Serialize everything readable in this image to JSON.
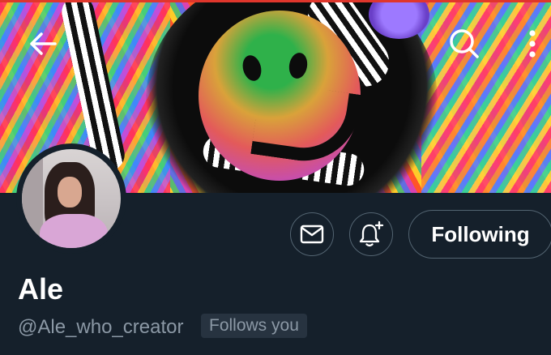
{
  "header": {
    "back_icon": "arrow-left-icon",
    "search_icon": "search-icon",
    "more_icon": "more-vertical-icon",
    "banner_image": "psychedelic-smiley-banner"
  },
  "profile": {
    "avatar_image": "profile-avatar",
    "display_name": "Ale",
    "handle": "@Ale_who_creator",
    "follows_you_label": "Follows you"
  },
  "actions": {
    "message_icon": "mail-icon",
    "notifications_icon": "bell-plus-icon",
    "following_label": "Following"
  },
  "colors": {
    "background": "#15202b",
    "secondary_text": "#8b98a5",
    "border": "#536471",
    "badge_bg": "#273340"
  }
}
